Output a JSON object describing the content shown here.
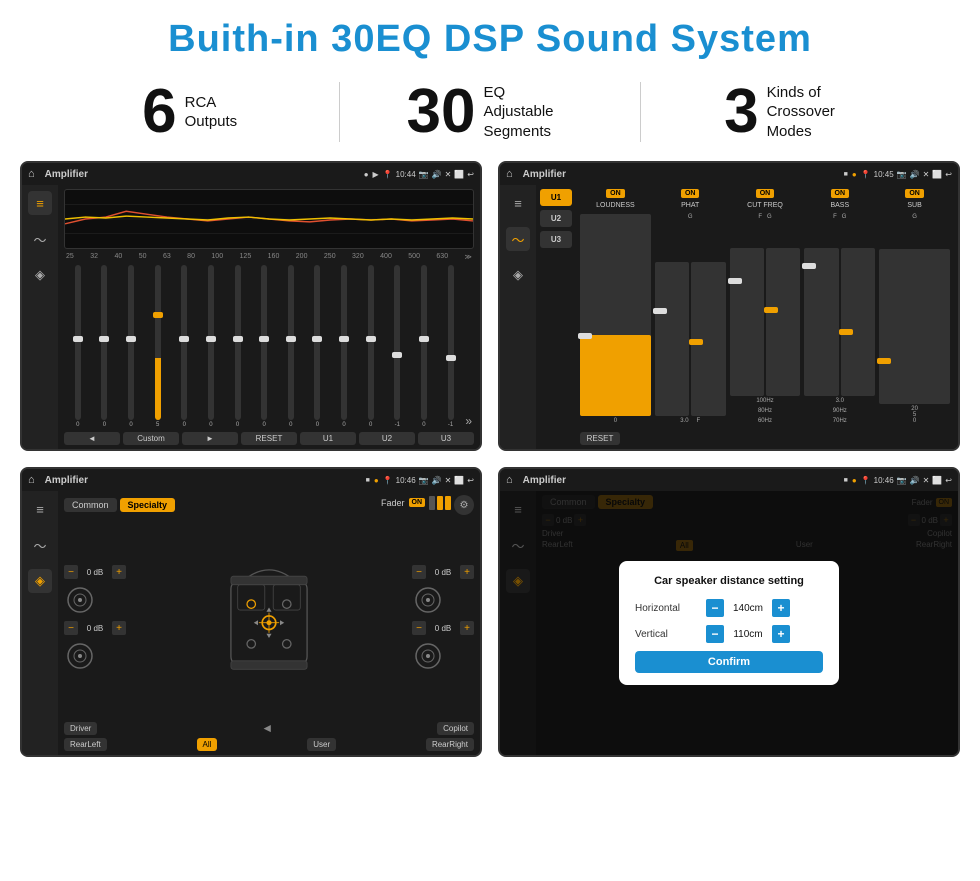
{
  "title": "Buith-in 30EQ DSP Sound System",
  "stats": [
    {
      "number": "6",
      "label_line1": "RCA",
      "label_line2": "Outputs"
    },
    {
      "number": "30",
      "label_line1": "EQ Adjustable",
      "label_line2": "Segments"
    },
    {
      "number": "3",
      "label_line1": "Kinds of",
      "label_line2": "Crossover Modes"
    }
  ],
  "screens": {
    "eq": {
      "title": "Amplifier",
      "time": "10:44",
      "freq_labels": [
        "25",
        "32",
        "40",
        "50",
        "63",
        "80",
        "100",
        "125",
        "160",
        "200",
        "250",
        "320",
        "400",
        "500",
        "630"
      ],
      "slider_values": [
        "0",
        "0",
        "0",
        "5",
        "0",
        "0",
        "0",
        "0",
        "0",
        "0",
        "0",
        "0",
        "-1",
        "0",
        "-1"
      ],
      "slider_positions": [
        50,
        50,
        50,
        35,
        50,
        50,
        50,
        50,
        50,
        50,
        50,
        50,
        60,
        50,
        62
      ],
      "buttons": [
        "◄",
        "Custom",
        "►",
        "RESET",
        "U1",
        "U2",
        "U3"
      ]
    },
    "crossover": {
      "title": "Amplifier",
      "time": "10:45",
      "presets": [
        "U1",
        "U2",
        "U3"
      ],
      "columns": [
        {
          "toggle": "ON",
          "label": "LOUDNESS"
        },
        {
          "toggle": "ON",
          "label": "PHAT"
        },
        {
          "toggle": "ON",
          "label": "CUT FREQ"
        },
        {
          "toggle": "ON",
          "label": "BASS"
        },
        {
          "toggle": "ON",
          "label": "SUB"
        }
      ],
      "reset": "RESET"
    },
    "speaker": {
      "title": "Amplifier",
      "time": "10:46",
      "tabs": [
        "Common",
        "Specialty"
      ],
      "active_tab": "Specialty",
      "fader_label": "Fader",
      "on_label": "ON",
      "db_values": [
        "0 dB",
        "0 dB",
        "0 dB",
        "0 dB"
      ],
      "buttons_bottom": [
        "Driver",
        "",
        "Copilot",
        "RearLeft",
        "All",
        "User",
        "RearRight"
      ]
    },
    "dialog": {
      "title": "Amplifier",
      "time": "10:46",
      "tabs": [
        "Common",
        "Specialty"
      ],
      "active_tab": "Specialty",
      "dialog_title": "Car speaker distance setting",
      "horizontal_label": "Horizontal",
      "horizontal_value": "140cm",
      "vertical_label": "Vertical",
      "vertical_value": "110cm",
      "confirm_label": "Confirm",
      "buttons_bottom": [
        "Driver",
        "Copilot",
        "RearLeft",
        "All",
        "User",
        "RearRight"
      ],
      "db_values": [
        "0 dB",
        "0 dB"
      ]
    }
  }
}
